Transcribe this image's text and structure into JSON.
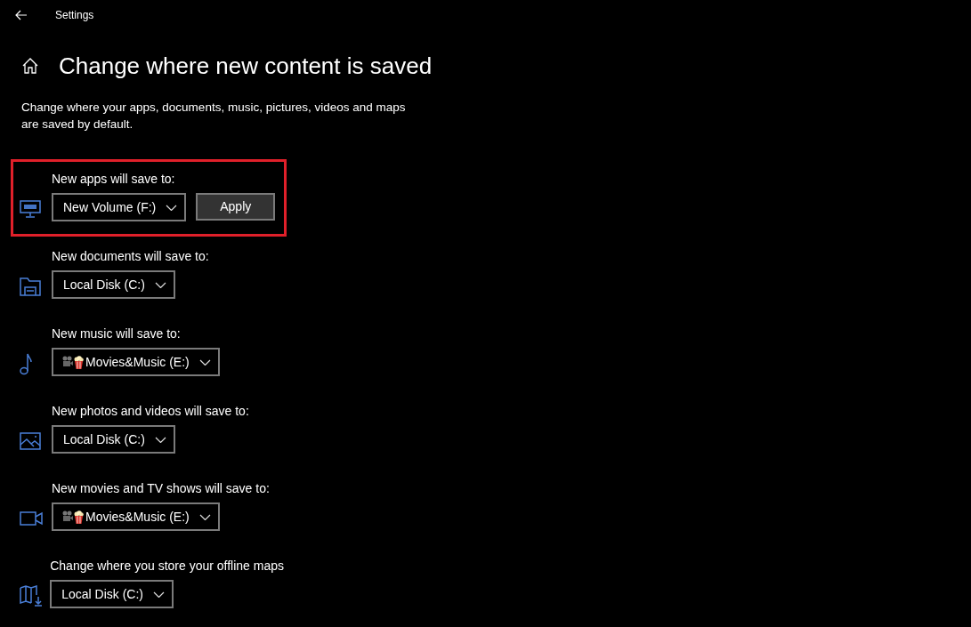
{
  "window": {
    "title": "Settings"
  },
  "page": {
    "title": "Change where new content is saved",
    "description": "Change where your apps, documents, music, pictures, videos and maps are saved by default."
  },
  "items": [
    {
      "kind": "apps",
      "label": "New apps will save to:",
      "value": "New Volume (F:)",
      "button": "Apply",
      "highlighted": true
    },
    {
      "kind": "documents",
      "label": "New documents will save to:",
      "value": "Local Disk (C:)",
      "highlighted": false
    },
    {
      "kind": "music",
      "label": "New music will save to:",
      "value": "Movies&Music (E:)",
      "volume_icons": true,
      "highlighted": false
    },
    {
      "kind": "photos",
      "label": "New photos and videos will save to:",
      "value": "Local Disk (C:)",
      "highlighted": false
    },
    {
      "kind": "movies",
      "label": "New movies and TV shows will save to:",
      "value": "Movies&Music (E:)",
      "volume_icons": true,
      "highlighted": false
    },
    {
      "kind": "maps",
      "label": "Change where you store your offline maps",
      "value": "Local Disk (C:)",
      "highlighted": false
    }
  ]
}
